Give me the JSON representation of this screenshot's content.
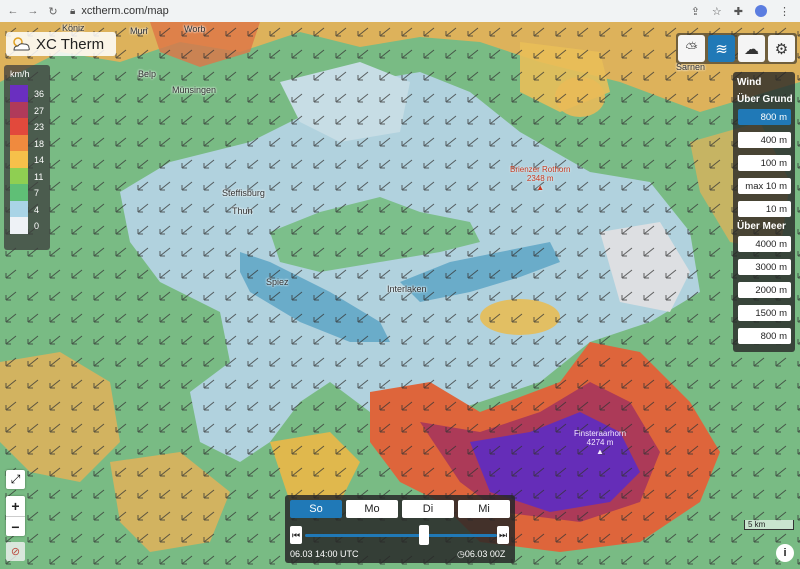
{
  "browser": {
    "url": "xctherm.com/map"
  },
  "app": {
    "logo_text": "XC Therm",
    "logo_icon": "cloud-sun-icon"
  },
  "legend": {
    "unit": "km/h",
    "values": [
      "36",
      "27",
      "23",
      "18",
      "14",
      "11",
      "7",
      "4",
      "0"
    ],
    "colors": [
      "#6a2fc0",
      "#b03a5a",
      "#e2493c",
      "#f08a3e",
      "#f6c04a",
      "#8fcf52",
      "#5fbf76",
      "#a9d4e6",
      "#eef2f6"
    ]
  },
  "places": [
    "Muri",
    "Worb",
    "Belp",
    "Münsingen",
    "Steffisburg",
    "Thun",
    "Spiez",
    "Interlaken",
    "Sarnen",
    "Köniz"
  ],
  "peaks": [
    {
      "name": "Brienzer Rothorn",
      "elev": "2348 m"
    },
    {
      "name": "Finsteraarhorn",
      "elev": "4274 m"
    }
  ],
  "top_buttons": [
    {
      "icon": "thermal-cloud-icon",
      "active": false
    },
    {
      "icon": "wind-icon",
      "active": true
    },
    {
      "icon": "cloud-cover-icon",
      "active": false
    },
    {
      "icon": "gear-icon",
      "active": false
    }
  ],
  "wind_panel": {
    "title": "Wind",
    "ground_header": "Über Grund",
    "ground_levels": [
      "800 m",
      "400 m",
      "100 m",
      "max 10 m",
      "10 m"
    ],
    "sea_header": "Über Meer",
    "sea_levels": [
      "4000 m",
      "3000 m",
      "2000 m",
      "1500 m",
      "800 m"
    ],
    "selected": "800 m"
  },
  "time": {
    "days": [
      "So",
      "Mo",
      "Di",
      "Mi"
    ],
    "selected_day": "So",
    "current": "06.03 14:00 UTC",
    "model_run": "06.03 00Z",
    "slider_fraction": 0.62
  },
  "scale_label": "5 km"
}
